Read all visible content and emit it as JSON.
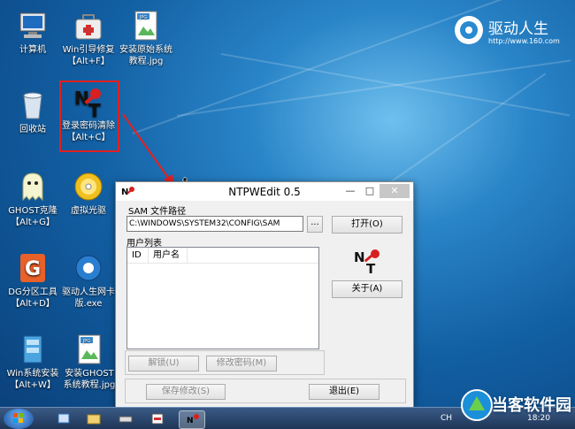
{
  "desktop": {
    "icons": [
      {
        "label_line1": "计算机",
        "label_line2": ""
      },
      {
        "label_line1": "Win引导修复",
        "label_line2": "【Alt+F】"
      },
      {
        "label_line1": "安装原始系统",
        "label_line2": "教程.jpg"
      },
      {
        "label_line1": "回收站",
        "label_line2": ""
      },
      {
        "label_line1": "登录密码清除",
        "label_line2": "【Alt+C】"
      },
      {
        "label_line1": "GHOST克隆",
        "label_line2": "【Alt+G】"
      },
      {
        "label_line1": "虚拟光驱",
        "label_line2": ""
      },
      {
        "label_line1": "DG分区工具",
        "label_line2": "【Alt+D】"
      },
      {
        "label_line1": "驱动人生网卡",
        "label_line2": "版.exe"
      },
      {
        "label_line1": "Win系统安装",
        "label_line2": "【Alt+W】"
      },
      {
        "label_line1": "安装GHOST",
        "label_line2": "系统教程.jpg"
      }
    ],
    "brand": {
      "name": "驱动人生",
      "url": "http://www.160.com"
    }
  },
  "dialog": {
    "title": "NTPWEdit 0.5",
    "sam_label": "SAM 文件路径",
    "sam_path": "C:\\WINDOWS\\SYSTEM32\\CONFIG\\SAM",
    "browse_label": "...",
    "open_label": "打开(O)",
    "user_list_label": "用户列表",
    "columns": [
      "ID",
      "用户名"
    ],
    "about_label": "关于(A)",
    "unlock_label": "解锁(U)",
    "change_pw_label": "修改密码(M)",
    "save_label": "保存修改(S)",
    "exit_label": "退出(E)"
  },
  "taskbar": {
    "lang": "CH",
    "time": "18:20"
  },
  "watermark": {
    "text": "当客软件园"
  }
}
